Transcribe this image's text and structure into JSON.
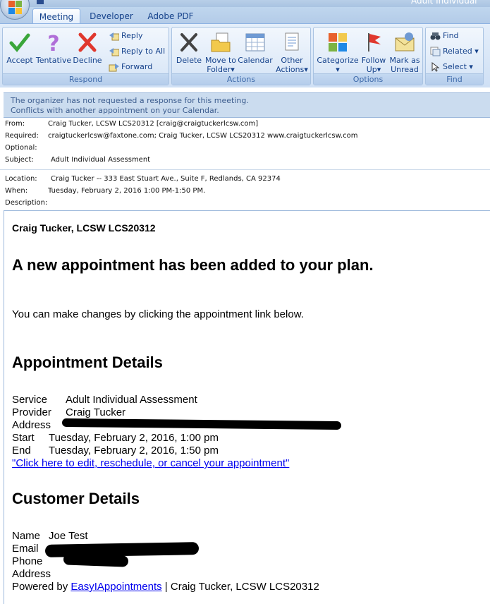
{
  "window": {
    "title": "Adult Individual"
  },
  "tabs": [
    "Meeting",
    "Developer",
    "Adobe PDF"
  ],
  "ribbon": {
    "groups": [
      "Respond",
      "Actions",
      "Options",
      "Find"
    ],
    "respond": {
      "accept": "Accept",
      "tentative": "Tentative",
      "decline": "Decline",
      "reply": "Reply",
      "reply_all": "Reply to All",
      "forward": "Forward"
    },
    "actions": {
      "delete": "Delete",
      "move_line1": "Move to",
      "move_line2": "Folder",
      "calendar": "Calendar",
      "other_line1": "Other",
      "other_line2": "Actions"
    },
    "options": {
      "categorize": "Categorize",
      "follow_line1": "Follow",
      "follow_line2": "Up",
      "mark_line1": "Mark as",
      "mark_line2": "Unread"
    },
    "find": {
      "find": "Find",
      "related": "Related",
      "select": "Select"
    }
  },
  "infobar": {
    "line1": "The organizer has not requested a response for this meeting.",
    "line2": "Conflicts with another appointment on your Calendar."
  },
  "header": {
    "from_label": "From:",
    "from": "Craig Tucker, LCSW LCS20312 [craig@craigtuckerlcsw.com]",
    "required_label": "Required:",
    "required": "craigtuckerlcsw@faxtone.com; Craig Tucker, LCSW LCS20312 www.craigtuckerlcsw.com",
    "optional_label": "Optional:",
    "optional": "",
    "subject_label": "Subject:",
    "subject": "Adult Individual Assessment",
    "location_label": "Location:",
    "location": "Craig Tucker -- 333 East Stuart Ave., Suite F, Redlands, CA 92374",
    "when_label": "When:",
    "when": "Tuesday, February 2, 2016 1:00 PM-1:50 PM.",
    "description_label": "Description:"
  },
  "body": {
    "sender": "Craig Tucker, LCSW LCS20312",
    "headline": "A new appointment has been added to your plan.",
    "intro": "You can make changes by clicking the appointment link below.",
    "appt_heading": "Appointment Details",
    "service_label": "Service",
    "service": "Adult Individual Assessment",
    "provider_label": "Provider",
    "provider": "Craig Tucker",
    "address_label": "Address",
    "start_label": "Start",
    "start": "Tuesday, February 2, 2016, 1:00 pm",
    "end_label": "End",
    "end": "Tuesday, February 2, 2016, 1:50 pm",
    "edit_link": "\"Click here to edit, reschedule, or cancel your appointment\"",
    "customer_heading": "Customer Details",
    "name_label": "Name",
    "name": "Joe Test",
    "email_label": "Email",
    "phone_label": "Phone",
    "cust_address_label": "Address",
    "powered_prefix": "Powered by ",
    "powered_link": "EasyIAppointments",
    "powered_suffix": " | Craig Tucker, LCSW LCS20312"
  }
}
